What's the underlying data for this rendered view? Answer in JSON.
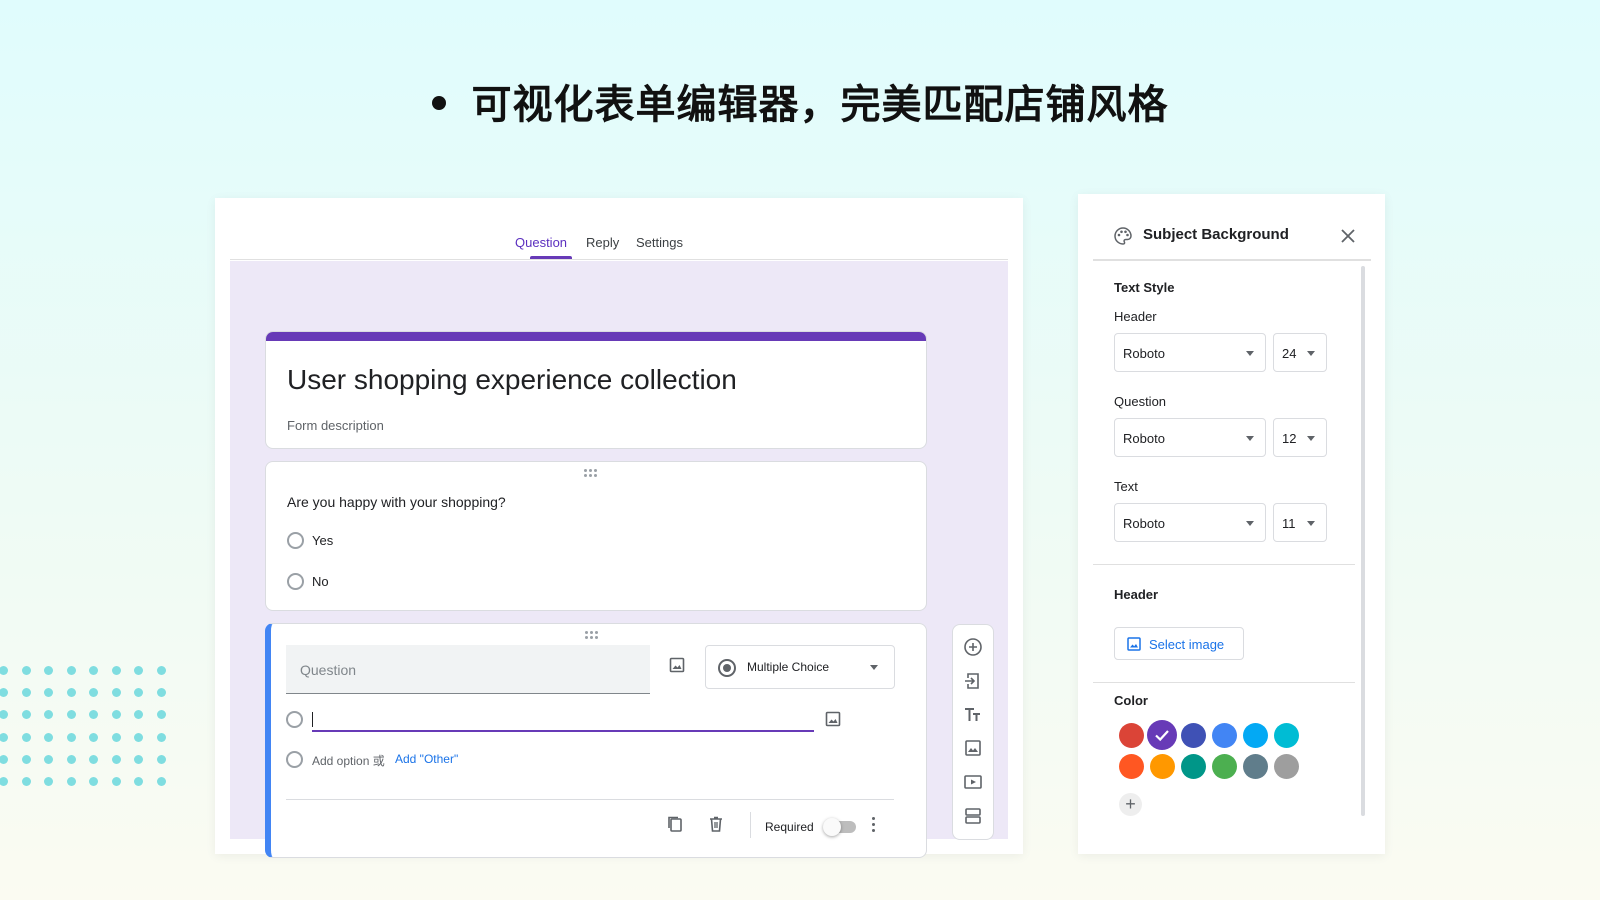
{
  "headline": "可视化表单编辑器，完美匹配店铺风格",
  "editor": {
    "tabs": [
      {
        "label": "Question",
        "active": true
      },
      {
        "label": "Reply",
        "active": false
      },
      {
        "label": "Settings",
        "active": false
      }
    ],
    "form_title": "User shopping experience collection",
    "form_description": "Form description",
    "question1": {
      "text": "Are you happy with your shopping?",
      "options": [
        "Yes",
        "No"
      ]
    },
    "question2": {
      "placeholder": "Question",
      "type_label": "Multiple Choice",
      "add_option": "Add option",
      "or_text": "或",
      "add_other": "Add \"Other\"",
      "required_label": "Required",
      "required": false
    },
    "toolbar_icons": [
      "add-question-icon",
      "import-question-icon",
      "add-title-icon",
      "add-image-icon",
      "add-video-icon",
      "add-section-icon"
    ]
  },
  "panel": {
    "title": "Subject Background",
    "text_style_title": "Text Style",
    "rows": [
      {
        "label": "Header",
        "font": "Roboto",
        "size": "24"
      },
      {
        "label": "Question",
        "font": "Roboto",
        "size": "12"
      },
      {
        "label": "Text",
        "font": "Roboto",
        "size": "11"
      }
    ],
    "header_title": "Header",
    "select_image": "Select image",
    "color_title": "Color",
    "colors": [
      "#db4437",
      "#673ab7",
      "#3f51b5",
      "#4285f4",
      "#03a9f4",
      "#00bcd4",
      "#ff5722",
      "#ff9800",
      "#009688",
      "#4caf50",
      "#607d8b",
      "#9e9e9e"
    ],
    "selected_color": "#673ab7",
    "accent": "#673ab7"
  }
}
